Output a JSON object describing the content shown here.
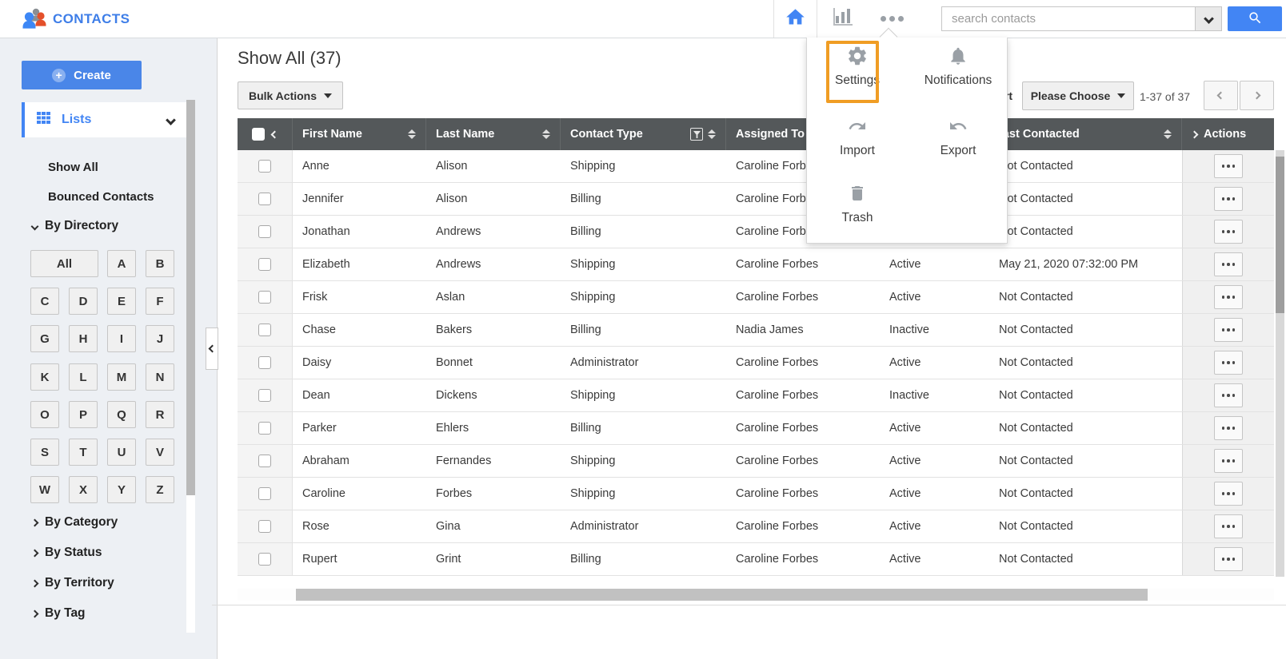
{
  "app": {
    "title": "CONTACTS"
  },
  "topbar": {
    "search": {
      "placeholder": "search contacts"
    },
    "icons": [
      "people-logo-icon",
      "home-icon",
      "bar-chart-icon",
      "more-dots-icon",
      "dropdown-chevron-icon",
      "search-icon"
    ]
  },
  "overflow_menu": {
    "items": [
      {
        "label": "Settings",
        "icon": "gear-icon",
        "highlighted": true
      },
      {
        "label": "Notifications",
        "icon": "bell-icon",
        "highlighted": false
      },
      {
        "label": "Import",
        "icon": "import-arrow-icon",
        "highlighted": false
      },
      {
        "label": "Export",
        "icon": "export-arrow-icon",
        "highlighted": false
      },
      {
        "label": "Trash",
        "icon": "trash-icon",
        "highlighted": false
      }
    ],
    "highlight_color": "#f09d24"
  },
  "sidebar": {
    "create_label": "Create",
    "lists_label": "Lists",
    "items": [
      {
        "label": "Show All"
      },
      {
        "label": "Bounced Contacts"
      }
    ],
    "directory": {
      "label": "By Directory",
      "expanded": true,
      "letters": [
        "All",
        "A",
        "B",
        "C",
        "D",
        "E",
        "F",
        "G",
        "H",
        "I",
        "J",
        "K",
        "L",
        "M",
        "N",
        "O",
        "P",
        "Q",
        "R",
        "S",
        "T",
        "U",
        "V",
        "W",
        "X",
        "Y",
        "Z"
      ]
    },
    "sections": [
      {
        "label": "By Category"
      },
      {
        "label": "By Status"
      },
      {
        "label": "By Territory"
      },
      {
        "label": "By Tag"
      }
    ]
  },
  "content": {
    "title": "Show All (37)",
    "bulk_actions_label": "Bulk Actions",
    "sort_label": "Sort",
    "sort_select_label": "Please Choose",
    "pagination": {
      "range": "1-37 of 37"
    }
  },
  "table": {
    "columns": [
      {
        "key": "select",
        "label": ""
      },
      {
        "key": "first_name",
        "label": "First Name",
        "sortable": true
      },
      {
        "key": "last_name",
        "label": "Last Name",
        "sortable": true
      },
      {
        "key": "contact_type",
        "label": "Contact Type",
        "sortable": true,
        "filterable": true
      },
      {
        "key": "assigned_to",
        "label": "Assigned To",
        "sortable": true
      },
      {
        "key": "status",
        "label": ""
      },
      {
        "key": "last_contacted",
        "label": "Last Contacted",
        "sortable": true
      },
      {
        "key": "actions",
        "label": "Actions"
      }
    ],
    "rows": [
      {
        "first_name": "Anne",
        "last_name": "Alison",
        "contact_type": "Shipping",
        "assigned_to": "Caroline Forbes",
        "status": "",
        "last_contacted": "Not Contacted"
      },
      {
        "first_name": "Jennifer",
        "last_name": "Alison",
        "contact_type": "Billing",
        "assigned_to": "Caroline Forbes",
        "status": "",
        "last_contacted": "Not Contacted"
      },
      {
        "first_name": "Jonathan",
        "last_name": "Andrews",
        "contact_type": "Billing",
        "assigned_to": "Caroline Forbes",
        "status": "",
        "last_contacted": "Not Contacted"
      },
      {
        "first_name": "Elizabeth",
        "last_name": "Andrews",
        "contact_type": "Shipping",
        "assigned_to": "Caroline Forbes",
        "status": "Active",
        "last_contacted": "May 21, 2020 07:32:00 PM"
      },
      {
        "first_name": "Frisk",
        "last_name": "Aslan",
        "contact_type": "Shipping",
        "assigned_to": "Caroline Forbes",
        "status": "Active",
        "last_contacted": "Not Contacted"
      },
      {
        "first_name": "Chase",
        "last_name": "Bakers",
        "contact_type": "Billing",
        "assigned_to": "Nadia James",
        "status": "Inactive",
        "last_contacted": "Not Contacted"
      },
      {
        "first_name": "Daisy",
        "last_name": "Bonnet",
        "contact_type": "Administrator",
        "assigned_to": "Caroline Forbes",
        "status": "Active",
        "last_contacted": "Not Contacted"
      },
      {
        "first_name": "Dean",
        "last_name": "Dickens",
        "contact_type": "Shipping",
        "assigned_to": "Caroline Forbes",
        "status": "Inactive",
        "last_contacted": "Not Contacted"
      },
      {
        "first_name": "Parker",
        "last_name": "Ehlers",
        "contact_type": "Billing",
        "assigned_to": "Caroline Forbes",
        "status": "Active",
        "last_contacted": "Not Contacted"
      },
      {
        "first_name": "Abraham",
        "last_name": "Fernandes",
        "contact_type": "Shipping",
        "assigned_to": "Caroline Forbes",
        "status": "Active",
        "last_contacted": "Not Contacted"
      },
      {
        "first_name": "Caroline",
        "last_name": "Forbes",
        "contact_type": "Shipping",
        "assigned_to": "Caroline Forbes",
        "status": "Active",
        "last_contacted": "Not Contacted"
      },
      {
        "first_name": "Rose",
        "last_name": "Gina",
        "contact_type": "Administrator",
        "assigned_to": "Caroline Forbes",
        "status": "Active",
        "last_contacted": "Not Contacted"
      },
      {
        "first_name": "Rupert",
        "last_name": "Grint",
        "contact_type": "Billing",
        "assigned_to": "Caroline Forbes",
        "status": "Active",
        "last_contacted": "Not Contacted"
      }
    ]
  },
  "colors": {
    "accent": "#4285f4",
    "table_header_bg": "#54585a",
    "highlight": "#f09d24",
    "sidebar_bg": "#edf0f4"
  }
}
